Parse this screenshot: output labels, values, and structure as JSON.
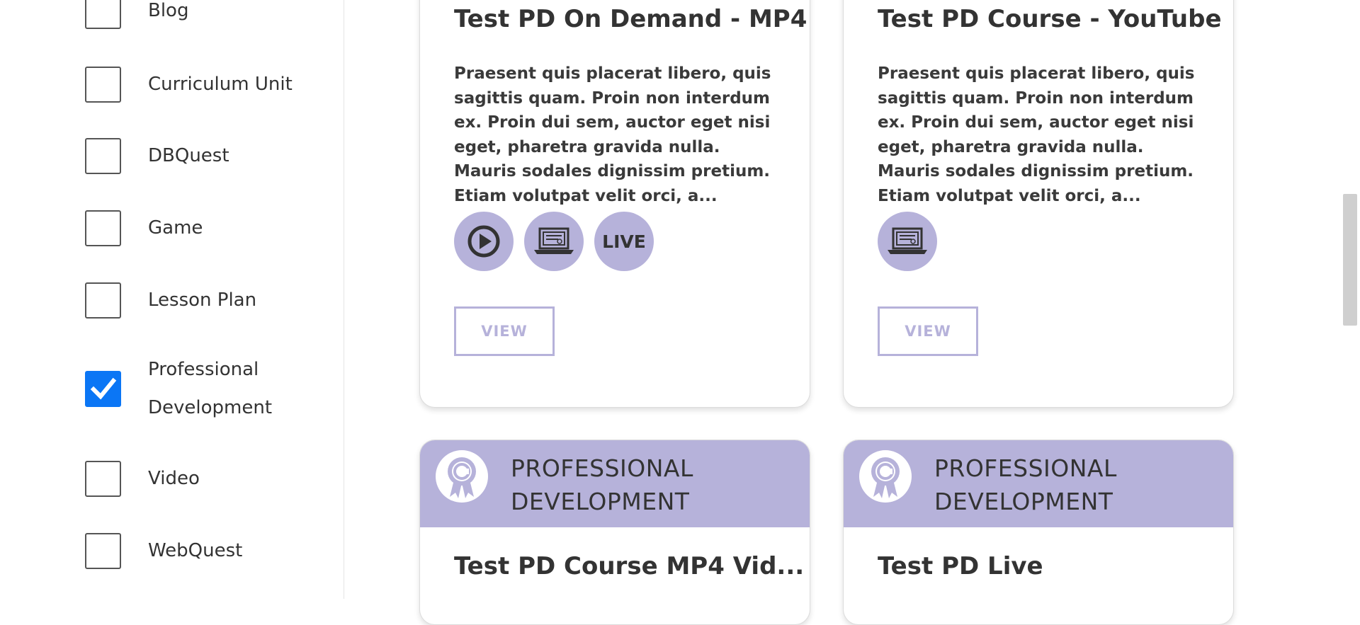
{
  "sidebar": {
    "filters": [
      {
        "label": "Blog",
        "checked": false
      },
      {
        "label": "Curriculum Unit",
        "checked": false
      },
      {
        "label": "DBQuest",
        "checked": false
      },
      {
        "label": "Game",
        "checked": false
      },
      {
        "label": "Lesson Plan",
        "checked": false
      },
      {
        "label": "Professional Development",
        "checked": true
      },
      {
        "label": "Video",
        "checked": false
      },
      {
        "label": "WebQuest",
        "checked": false
      }
    ]
  },
  "cards": [
    {
      "title": "Test PD On Demand - MP4",
      "description": "Praesent quis placerat libero, quis sagittis quam. Proin non interdum ex. Proin dui sem, auctor eget nisi eget, pharetra gravida nulla. Mauris sodales dignissim pretium. Etiam volutpat velit orci, a...",
      "icons": [
        "play-icon",
        "laptop-icon",
        "live-icon"
      ],
      "live_label": "LIVE",
      "view_label": "VIEW"
    },
    {
      "title": "Test PD Course - YouTube",
      "description": "Praesent quis placerat libero, quis sagittis quam. Proin non interdum ex. Proin dui sem, auctor eget nisi eget, pharetra gravida nulla. Mauris sodales dignissim pretium. Etiam volutpat velit orci, a...",
      "icons": [
        "laptop-icon"
      ],
      "view_label": "VIEW"
    },
    {
      "category": "PROFESSIONAL DEVELOPMENT",
      "title": "Test PD Course MP4 Vid..."
    },
    {
      "category": "PROFESSIONAL DEVELOPMENT",
      "title": "Test PD Live"
    }
  ],
  "colors": {
    "accent": "#b6b2da",
    "checkbox_checked": "#0b76f5",
    "text": "#333333"
  }
}
